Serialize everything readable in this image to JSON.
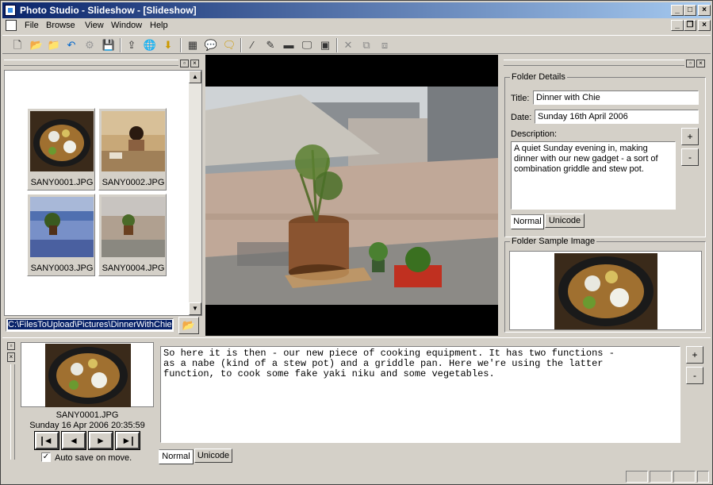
{
  "window": {
    "title": "Photo Studio - Slideshow - [Slideshow]"
  },
  "menu": [
    "File",
    "Browse",
    "View",
    "Window",
    "Help"
  ],
  "thumbnails": [
    {
      "name": "SANY0001.JPG"
    },
    {
      "name": "SANY0002.JPG"
    },
    {
      "name": "SANY0003.JPG"
    },
    {
      "name": "SANY0004.JPG"
    }
  ],
  "path": {
    "value": "C:\\FilesToUpload\\Pictures\\DinnerWithChie"
  },
  "folder": {
    "details_legend": "Folder Details",
    "title_label": "Title:",
    "title_value": "Dinner with Chie",
    "date_label": "Date:",
    "date_value": "Sunday 16th April 2006",
    "desc_label": "Description:",
    "desc_value": "A quiet Sunday evening in, making dinner with our new gadget - a sort of combination griddle and stew pot.",
    "sample_legend": "Folder Sample Image",
    "tab_normal": "Normal",
    "tab_unicode": "Unicode"
  },
  "current": {
    "filename": "SANY0001.JPG",
    "datetime": "Sunday 16 Apr 2006 20:35:59",
    "autosave_label": "Auto save on move.",
    "autosave_checked": true,
    "caption": "So here it is then - our new piece of cooking equipment. It has two functions -\nas a nabe (kind of a stew pot) and a griddle pan. Here we're using the latter\nfunction, to cook some fake yaki niku and some vegetables.",
    "tab_normal": "Normal",
    "tab_unicode": "Unicode"
  },
  "buttons": {
    "plus": "+",
    "minus": "-"
  }
}
